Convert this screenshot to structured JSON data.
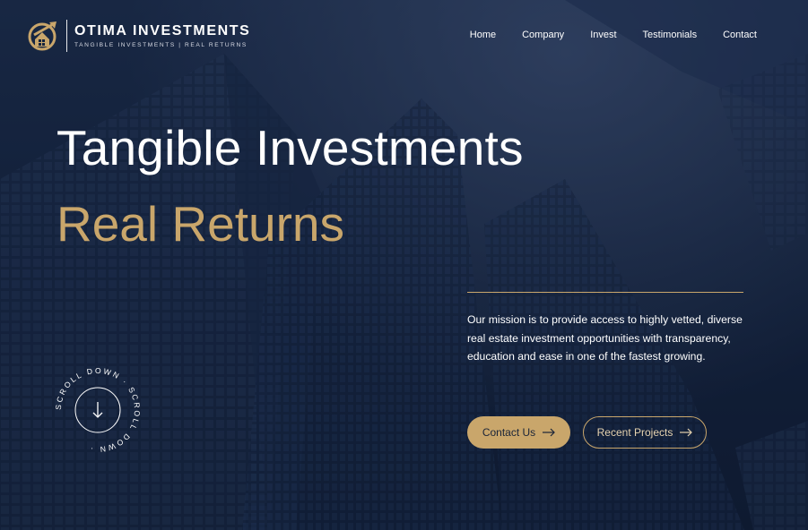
{
  "brand": {
    "name": "OTIMA INVESTMENTS",
    "tagline": "TANGIBLE INVESTMENTS | REAL RETURNS",
    "logo_icon": "house-arrow-logo-icon",
    "colors": {
      "gold": "#c9a66b",
      "navy": "#14233d",
      "text": "#ffffff"
    }
  },
  "nav": {
    "items": [
      {
        "label": "Home"
      },
      {
        "label": "Company"
      },
      {
        "label": "Invest"
      },
      {
        "label": "Testimonials"
      },
      {
        "label": "Contact"
      }
    ]
  },
  "hero": {
    "headline_line1": "Tangible Investments",
    "headline_line2": "Real Returns",
    "mission": "Our mission is to provide access to highly vetted, diverse real estate investment opportunities with transparency, education and ease in one of the fastest growing.",
    "primary_cta": {
      "label": "Contact Us",
      "icon": "arrow-right-icon"
    },
    "secondary_cta": {
      "label": "Recent Projects",
      "icon": "arrow-right-icon"
    },
    "scroll_badge": {
      "text": "SCROLL DOWN · SCROLL DOWN · ",
      "icon": "arrow-down-icon"
    }
  }
}
